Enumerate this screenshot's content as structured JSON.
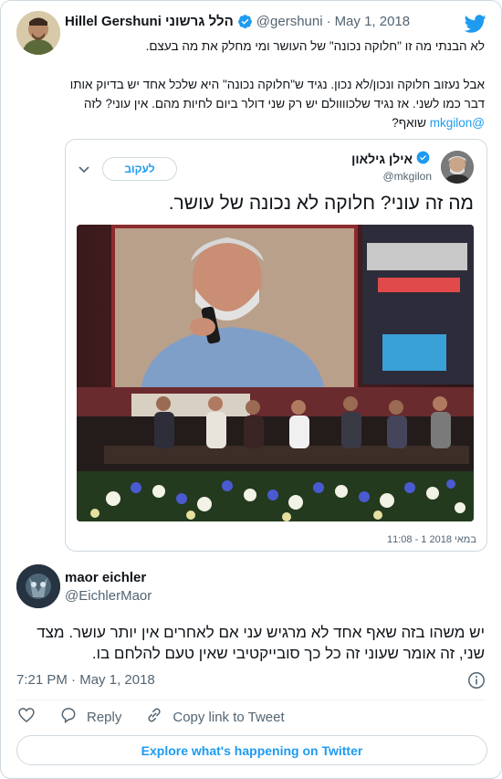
{
  "outer_tweet": {
    "author_name": "Hillel Gershuni הלל גרשוני",
    "author_handle": "@gershuni",
    "separator": "·",
    "date": "May 1, 2018",
    "paragraph_1": "לא הבנתי מה זו \"חלוקה נכונה\" של העושר ומי מחלק את מה בעצם.",
    "paragraph_2_part_1": "אבל נעזוב חלוקה ונכון/לא נכון. נגיד ש\"חלוקה נכונה\" היא שלכל אחד יש בדיוק אותו דבר כמו לשני. אז נגיד שלכוווולם יש רק שני דולר ביום לחיות מהם. אין עוני? לזה ",
    "paragraph_2_mention": "@mkgilon",
    "paragraph_2_part_2": " שואף?"
  },
  "quoted_tweet": {
    "author_name": "אילן גילאון",
    "author_handle": "@mkgilon",
    "follow_label": "לעקוב",
    "text": "מה זה עוני? חלוקה לא נכונה של עושר.",
    "timestamp": "11:08 - 1 במאי 2018"
  },
  "reply_tweet": {
    "author_name": "maor eichler",
    "author_handle": "@EichlerMaor",
    "text": "יש משהו בזה שאף אחד לא מרגיש עני אם לאחרים אין יותר עושר. מצד שני, זה אומר שעוני זה כל כך סובייקטיבי שאין טעם להלחם בו.",
    "time": "7:21 PM",
    "separator": "·",
    "date": "May 1, 2018"
  },
  "actions": {
    "reply_label": "Reply",
    "copy_link_label": "Copy link to Tweet"
  },
  "explore_label": "Explore what's happening on Twitter",
  "icons": {
    "twitter": "twitter-bird-icon",
    "verified": "verified-badge-icon",
    "like": "heart-icon",
    "reply": "speech-bubble-icon",
    "copy_link": "link-icon",
    "info": "info-icon",
    "chevron": "chevron-down-icon"
  },
  "colors": {
    "accent": "#1d9bf0",
    "text": "#0f1419",
    "muted": "#536471",
    "border": "#cfd9de"
  }
}
